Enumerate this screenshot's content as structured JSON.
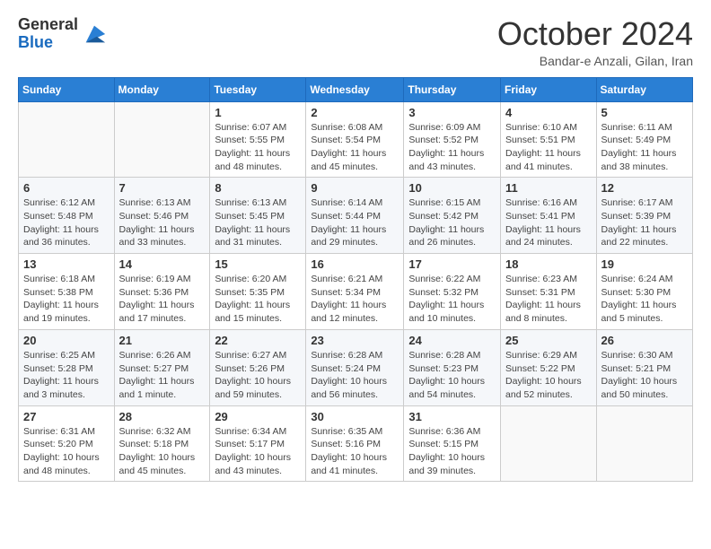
{
  "logo": {
    "general": "General",
    "blue": "Blue"
  },
  "header": {
    "month": "October 2024",
    "location": "Bandar-e Anzali, Gilan, Iran"
  },
  "days_of_week": [
    "Sunday",
    "Monday",
    "Tuesday",
    "Wednesday",
    "Thursday",
    "Friday",
    "Saturday"
  ],
  "weeks": [
    [
      {
        "day": "",
        "info": ""
      },
      {
        "day": "",
        "info": ""
      },
      {
        "day": "1",
        "info": "Sunrise: 6:07 AM\nSunset: 5:55 PM\nDaylight: 11 hours and 48 minutes."
      },
      {
        "day": "2",
        "info": "Sunrise: 6:08 AM\nSunset: 5:54 PM\nDaylight: 11 hours and 45 minutes."
      },
      {
        "day": "3",
        "info": "Sunrise: 6:09 AM\nSunset: 5:52 PM\nDaylight: 11 hours and 43 minutes."
      },
      {
        "day": "4",
        "info": "Sunrise: 6:10 AM\nSunset: 5:51 PM\nDaylight: 11 hours and 41 minutes."
      },
      {
        "day": "5",
        "info": "Sunrise: 6:11 AM\nSunset: 5:49 PM\nDaylight: 11 hours and 38 minutes."
      }
    ],
    [
      {
        "day": "6",
        "info": "Sunrise: 6:12 AM\nSunset: 5:48 PM\nDaylight: 11 hours and 36 minutes."
      },
      {
        "day": "7",
        "info": "Sunrise: 6:13 AM\nSunset: 5:46 PM\nDaylight: 11 hours and 33 minutes."
      },
      {
        "day": "8",
        "info": "Sunrise: 6:13 AM\nSunset: 5:45 PM\nDaylight: 11 hours and 31 minutes."
      },
      {
        "day": "9",
        "info": "Sunrise: 6:14 AM\nSunset: 5:44 PM\nDaylight: 11 hours and 29 minutes."
      },
      {
        "day": "10",
        "info": "Sunrise: 6:15 AM\nSunset: 5:42 PM\nDaylight: 11 hours and 26 minutes."
      },
      {
        "day": "11",
        "info": "Sunrise: 6:16 AM\nSunset: 5:41 PM\nDaylight: 11 hours and 24 minutes."
      },
      {
        "day": "12",
        "info": "Sunrise: 6:17 AM\nSunset: 5:39 PM\nDaylight: 11 hours and 22 minutes."
      }
    ],
    [
      {
        "day": "13",
        "info": "Sunrise: 6:18 AM\nSunset: 5:38 PM\nDaylight: 11 hours and 19 minutes."
      },
      {
        "day": "14",
        "info": "Sunrise: 6:19 AM\nSunset: 5:36 PM\nDaylight: 11 hours and 17 minutes."
      },
      {
        "day": "15",
        "info": "Sunrise: 6:20 AM\nSunset: 5:35 PM\nDaylight: 11 hours and 15 minutes."
      },
      {
        "day": "16",
        "info": "Sunrise: 6:21 AM\nSunset: 5:34 PM\nDaylight: 11 hours and 12 minutes."
      },
      {
        "day": "17",
        "info": "Sunrise: 6:22 AM\nSunset: 5:32 PM\nDaylight: 11 hours and 10 minutes."
      },
      {
        "day": "18",
        "info": "Sunrise: 6:23 AM\nSunset: 5:31 PM\nDaylight: 11 hours and 8 minutes."
      },
      {
        "day": "19",
        "info": "Sunrise: 6:24 AM\nSunset: 5:30 PM\nDaylight: 11 hours and 5 minutes."
      }
    ],
    [
      {
        "day": "20",
        "info": "Sunrise: 6:25 AM\nSunset: 5:28 PM\nDaylight: 11 hours and 3 minutes."
      },
      {
        "day": "21",
        "info": "Sunrise: 6:26 AM\nSunset: 5:27 PM\nDaylight: 11 hours and 1 minute."
      },
      {
        "day": "22",
        "info": "Sunrise: 6:27 AM\nSunset: 5:26 PM\nDaylight: 10 hours and 59 minutes."
      },
      {
        "day": "23",
        "info": "Sunrise: 6:28 AM\nSunset: 5:24 PM\nDaylight: 10 hours and 56 minutes."
      },
      {
        "day": "24",
        "info": "Sunrise: 6:28 AM\nSunset: 5:23 PM\nDaylight: 10 hours and 54 minutes."
      },
      {
        "day": "25",
        "info": "Sunrise: 6:29 AM\nSunset: 5:22 PM\nDaylight: 10 hours and 52 minutes."
      },
      {
        "day": "26",
        "info": "Sunrise: 6:30 AM\nSunset: 5:21 PM\nDaylight: 10 hours and 50 minutes."
      }
    ],
    [
      {
        "day": "27",
        "info": "Sunrise: 6:31 AM\nSunset: 5:20 PM\nDaylight: 10 hours and 48 minutes."
      },
      {
        "day": "28",
        "info": "Sunrise: 6:32 AM\nSunset: 5:18 PM\nDaylight: 10 hours and 45 minutes."
      },
      {
        "day": "29",
        "info": "Sunrise: 6:34 AM\nSunset: 5:17 PM\nDaylight: 10 hours and 43 minutes."
      },
      {
        "day": "30",
        "info": "Sunrise: 6:35 AM\nSunset: 5:16 PM\nDaylight: 10 hours and 41 minutes."
      },
      {
        "day": "31",
        "info": "Sunrise: 6:36 AM\nSunset: 5:15 PM\nDaylight: 10 hours and 39 minutes."
      },
      {
        "day": "",
        "info": ""
      },
      {
        "day": "",
        "info": ""
      }
    ]
  ]
}
